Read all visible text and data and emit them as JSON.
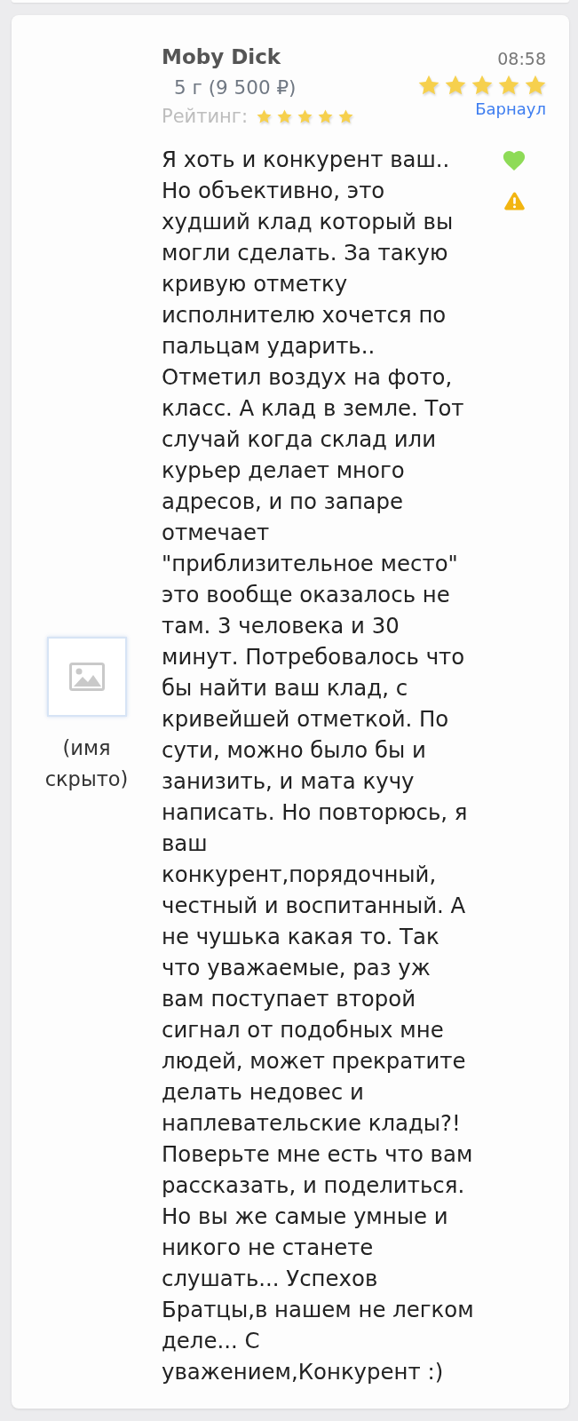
{
  "review": {
    "author": "Moby Dick",
    "product": "5 г (9 500 ₽)",
    "rating": {
      "label": "Рейтинг:",
      "stars": 5
    },
    "time": "08:58",
    "score": {
      "stars": 5
    },
    "city": "Барнаул",
    "text": "Я хоть и конкурент ваш.. Но объективно, это худший клад который вы могли сделать. За такую кривую отметку исполнителю хочется по пальцам ударить.. Отметил воздух на фото, класс. А клад в земле. Тот случай когда склад или курьер делает много адресов, и по запаре отмечает \"приблизительное место\" это вообще оказалось не там. 3 человека и 30 минут. Потребовалось что бы найти ваш клад, с кривейшей отметкой. По сути, можно было бы и занизить, и мата кучу написать. Но повторюсь, я ваш конкурент,порядочный, честный и воспитанный. А не чушька какая то. Так что уважаемые, раз уж вам поступает второй сигнал от подобных мне людей, может прекратите делать недовес и наплевательские клады?! Поверьте мне есть что вам рассказать, и поделиться. Но вы же самые умные и никого не станете слушать... Успехов Братцы,в нашем не легком деле... С уважением,Конкурент :)",
    "reviewer": {
      "name": "(имя скрыто)"
    }
  }
}
